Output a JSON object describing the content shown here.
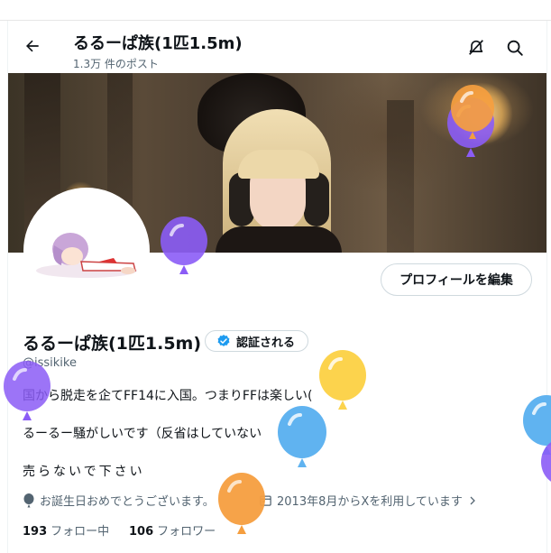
{
  "header": {
    "title": "るるーぱ族(1匹1.5m)",
    "post_count": "1.3万 件のポスト"
  },
  "profile": {
    "edit_label": "プロフィールを編集",
    "name": "るるーぱ族(1匹1.5m)",
    "verify_label": "認証される",
    "handle": "@issikike",
    "bio_lines": [
      "国から脱走を企てFF14に入国。つまりFFは楽しい(",
      "るーるー騒がしいです（反省はしていない",
      "売らないで下さい"
    ],
    "birthday": "お誕生日おめでとうございます。",
    "joined": "2013年8月からXを利用しています",
    "following_count": "193",
    "following_label": "フォロー中",
    "followers_count": "106",
    "followers_label": "フォロワー"
  },
  "colors": {
    "accent": "#1d9bf0",
    "balloon_purple": "#8b5cf6",
    "balloon_orange": "#f59e3f",
    "balloon_yellow": "#fcd34d",
    "balloon_blue": "#60b3f0"
  },
  "icons": [
    "back-arrow-icon",
    "bell-slash-icon",
    "search-icon",
    "verified-badge-icon",
    "balloon-icon",
    "calendar-icon",
    "chevron-right-icon"
  ]
}
